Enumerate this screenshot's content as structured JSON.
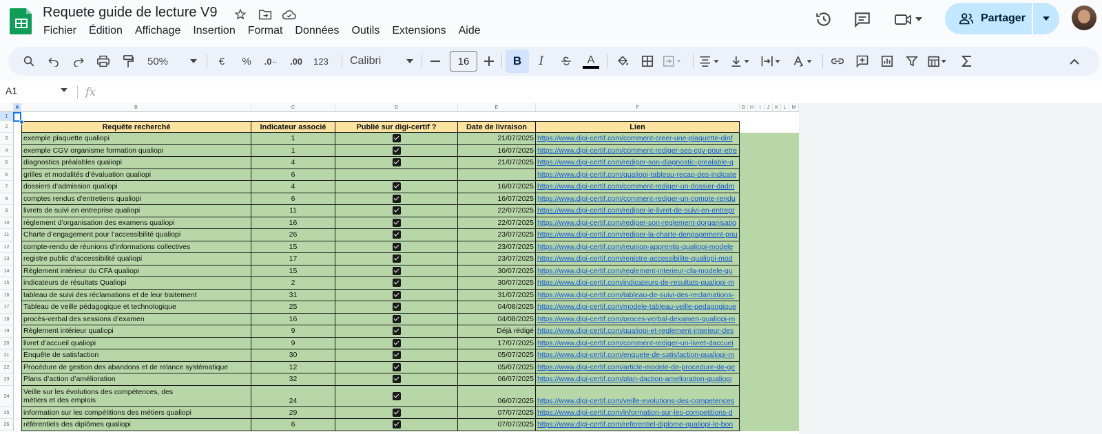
{
  "doc": {
    "title": "Requete guide de lecture V9"
  },
  "menu": [
    "Fichier",
    "Édition",
    "Affichage",
    "Insertion",
    "Format",
    "Données",
    "Outils",
    "Extensions",
    "Aide"
  ],
  "header_actions": {
    "share_label": "Partager"
  },
  "toolbar": {
    "zoom": "50%",
    "currency": "€",
    "percent": "%",
    "dec_decrease": ".0",
    "dec_increase": ".00",
    "number_format": "123",
    "font": "Calibri",
    "font_size": "16",
    "bold": "B",
    "italic": "I",
    "text_color": "A"
  },
  "formula_bar": {
    "cell_ref": "A1",
    "fx": "fx"
  },
  "columns": [
    "A",
    "B",
    "C",
    "D",
    "E",
    "F",
    "G",
    "H",
    "I",
    "J",
    "K",
    "L",
    "M"
  ],
  "row_numbers": [
    "1",
    "2",
    "3",
    "4",
    "5",
    "6",
    "7",
    "8",
    "9",
    "10",
    "11",
    "12",
    "13",
    "14",
    "15",
    "16",
    "17",
    "18",
    "19",
    "20",
    "21",
    "22",
    "23",
    "24",
    "25",
    "26"
  ],
  "table": {
    "headers": [
      "Requête recherché",
      "Indicateur associé",
      "Publié sur digi-certif ?",
      "Date de livraison",
      "Lien"
    ],
    "rows": [
      {
        "q": "exemple plaquette qualiopi",
        "ind": "1",
        "pub": true,
        "date": "21/07/2025",
        "link": "https://www.digi-certif.com/comment-creer-une-plaquette-dinf"
      },
      {
        "q": "exemple CGV organisme formation qualiopi",
        "ind": "1",
        "pub": true,
        "date": "16/07/2025",
        "link": "https://www.digi-certif.com/comment-rediger-ses-cgv-pour-etre"
      },
      {
        "q": "diagnostics préalables qualiopi",
        "ind": "4",
        "pub": true,
        "date": "21/07/2025",
        "link": "https://www.digi-certif.com/rediger-son-diagnostic-prealable-q"
      },
      {
        "q": "grilles et modalités d’évaluation qualiopi",
        "ind": "6",
        "pub": false,
        "date": "",
        "link": "https://www.digi-certif.com/qualiopi-tableau-recap-des-indicate"
      },
      {
        "q": "dossiers d’admission qualiopi",
        "ind": "4",
        "pub": true,
        "date": "16/07/2025",
        "link": "https://www.digi-certif.com/comment-rediger-un-dossier-dadm"
      },
      {
        "q": "comptes rendus d’entretiens qualiopi",
        "ind": "6",
        "pub": true,
        "date": "16/07/2025",
        "link": "https://www.digi-certif.com/comment-rediger-un-compte-rendu"
      },
      {
        "q": "livrets de suivi en entreprise qualiopi",
        "ind": "11",
        "pub": true,
        "date": "22/07/2025",
        "link": "https://www.digi-certif.com/rediger-le-livret-de-suivi-en-entrepr"
      },
      {
        "q": "règlement d’organisation des examens qualiopi",
        "ind": "16",
        "pub": true,
        "date": "22/07/2025",
        "link": "https://www.digi-certif.com/rediger-son-reglement-dorganisatio"
      },
      {
        "q": "Charte d’engagement pour l’accessibilité qualiopi",
        "ind": "26",
        "pub": true,
        "date": "23/07/2025",
        "link": "https://www.digi-certif.com/rediger-la-charte-dengagement-pou"
      },
      {
        "q": "compte-rendu de réunions d’informations collectives",
        "ind": "15",
        "pub": true,
        "date": "23/07/2025",
        "link": "https://www.digi-certif.com/reunion-apprentis-qualiopi-modele"
      },
      {
        "q": "registre public d’accessibilité qualiopi",
        "ind": "17",
        "pub": true,
        "date": "23/07/2025",
        "link": "https://www.digi-certif.com/registre-accessibilite-qualiopi-mod"
      },
      {
        "q": "Règlement intérieur du CFA qualiopi",
        "ind": "15",
        "pub": true,
        "date": "30/07/2025",
        "link": "https://www.digi-certif.com/reglement-interieur-cfa-modele-qu"
      },
      {
        "q": "indicateurs de résultats Qualiopi",
        "ind": "2",
        "pub": true,
        "date": "30/07/2025",
        "link": "https://www.digi-certif.com/indicateurs-de-resultats-qualiopi-m"
      },
      {
        "q": "tableau de suivi des réclamations et de leur traitement",
        "ind": "31",
        "pub": true,
        "date": "31/07/2025",
        "link": "https://www.digi-certif.com/tableau-de-suivi-des-reclamations-"
      },
      {
        "q": "Tableau de veille pédagogique et technologique",
        "ind": "25",
        "pub": true,
        "date": "04/08/2025",
        "link": "https://www.digi-certif.com/modele-tableau-veille-pedagogique"
      },
      {
        "q": "procès-verbal des sessions d’examen",
        "ind": "16",
        "pub": true,
        "date": "04/08/2025",
        "link": "https://www.digi-certif.com/proces-verbal-dexamen-qualiopi-m"
      },
      {
        "q": "Règlement intérieur qualiopi",
        "ind": "9",
        "pub": true,
        "date": "Déjà rédigé",
        "link": "https://www.digi-certif.com/qualiopi-et-reglement-interieur-des"
      },
      {
        "q": "livret d’accueil qualiopi",
        "ind": "9",
        "pub": true,
        "date": "17/07/2025",
        "link": "https://www.digi-certif.com/comment-rediger-un-livret-daccuei"
      },
      {
        "q": "Enquête de satisfaction",
        "ind": "30",
        "pub": true,
        "date": "05/07/2025",
        "link": "https://www.digi-certif.com/enquete-de-satisfaction-qualiopi-m"
      },
      {
        "q": "Procédure de gestion des abandons et de relance systématique",
        "ind": "12",
        "pub": true,
        "date": "05/07/2025",
        "link": "https://www.digi-certif.com/article-modele-de-procedure-de-ge"
      },
      {
        "q": "Plans d’action d’amélioration",
        "ind": "32",
        "pub": true,
        "date": "06/07/2025",
        "link": "https://www.digi-certif.com/plan-daction-amelioration-qualiopi"
      },
      {
        "q": "Veille sur les évolutions des compétences, des",
        "q2": "métiers et des emplois",
        "ind": "24",
        "pub": true,
        "date": "06/07/2025",
        "link": "https://www.digi-certif.com/veille-evolutions-des-competences"
      },
      {
        "q": "information sur les compétitions des métiers qualiopi",
        "ind": "29",
        "pub": true,
        "date": "07/07/2025",
        "link": "https://www.digi-certif.com/information-sur-les-competitions-d"
      },
      {
        "q": "référentiels des diplômes qualiopi",
        "ind": "6",
        "pub": true,
        "date": "07/07/2025",
        "link": "https://www.digi-certif.com/referentiel-diplome-qualiopi-le-bon"
      }
    ]
  },
  "colors": {
    "header_fill": "#fce4a0",
    "row_fill": "#b7d7a8",
    "link": "#1155cc",
    "share_button": "#c2e7ff",
    "sheets_green": "#0f9d58"
  }
}
